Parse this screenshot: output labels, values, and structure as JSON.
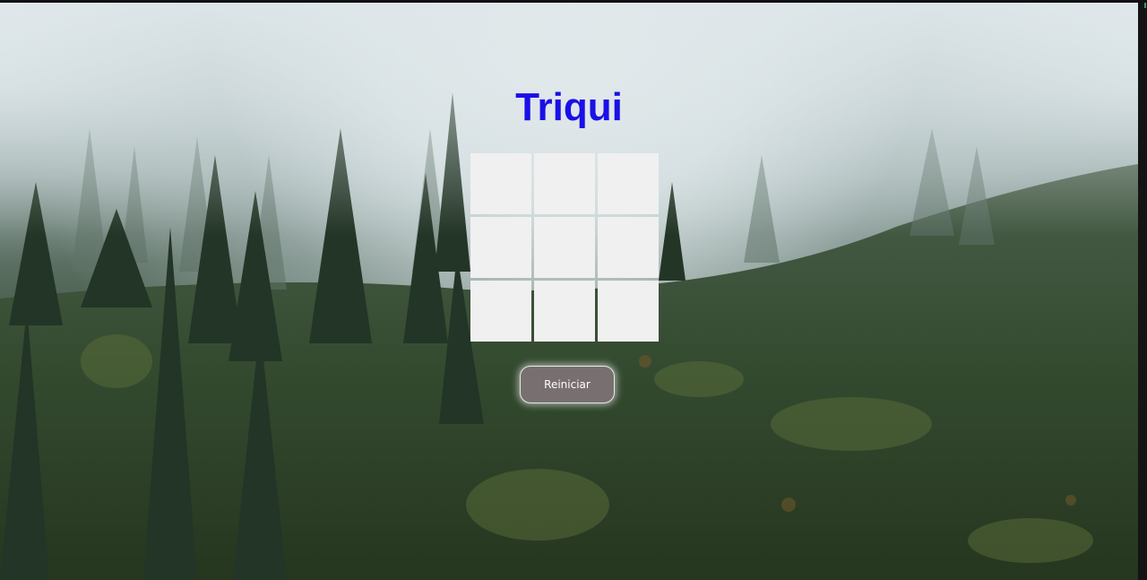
{
  "game": {
    "title": "Triqui",
    "board": [
      "",
      "",
      "",
      "",
      "",
      "",
      "",
      "",
      ""
    ],
    "reset_label": "Reiniciar"
  },
  "colors": {
    "title": "#1a10e6",
    "cell": "#f0f0f0",
    "button": "#787070"
  }
}
